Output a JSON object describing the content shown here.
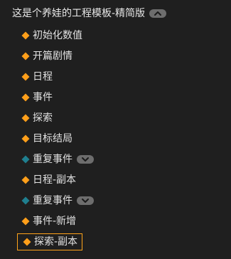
{
  "tree": {
    "root": {
      "label": "这是个养娃的工程模板-精简版",
      "expanded": true,
      "toggle_icon": "chevron-up-icon"
    },
    "colors": {
      "background": "#1f1f1f",
      "event_icon": "#ff9f1a",
      "repeat_icon": "#1f7f8f",
      "selected_border": "#ffa31a",
      "toggle_bg": "#6d6d6d"
    },
    "items": [
      {
        "label": "初始化数值",
        "icon": "orange-diamond-icon"
      },
      {
        "label": "开篇剧情",
        "icon": "orange-diamond-icon"
      },
      {
        "label": "日程",
        "icon": "orange-diamond-icon"
      },
      {
        "label": "事件",
        "icon": "orange-diamond-icon"
      },
      {
        "label": "探索",
        "icon": "orange-diamond-icon"
      },
      {
        "label": "目标结局",
        "icon": "orange-diamond-icon"
      },
      {
        "label": "重复事件",
        "icon": "teal-diamond-icon",
        "toggle_icon": "chevron-down-icon"
      },
      {
        "label": "日程-副本",
        "icon": "orange-diamond-icon"
      },
      {
        "label": "重复事件",
        "icon": "teal-diamond-icon",
        "toggle_icon": "chevron-down-icon"
      },
      {
        "label": "事件-新增",
        "icon": "orange-diamond-icon"
      },
      {
        "label": "探索-副本",
        "icon": "orange-diamond-icon",
        "selected": true
      }
    ]
  }
}
